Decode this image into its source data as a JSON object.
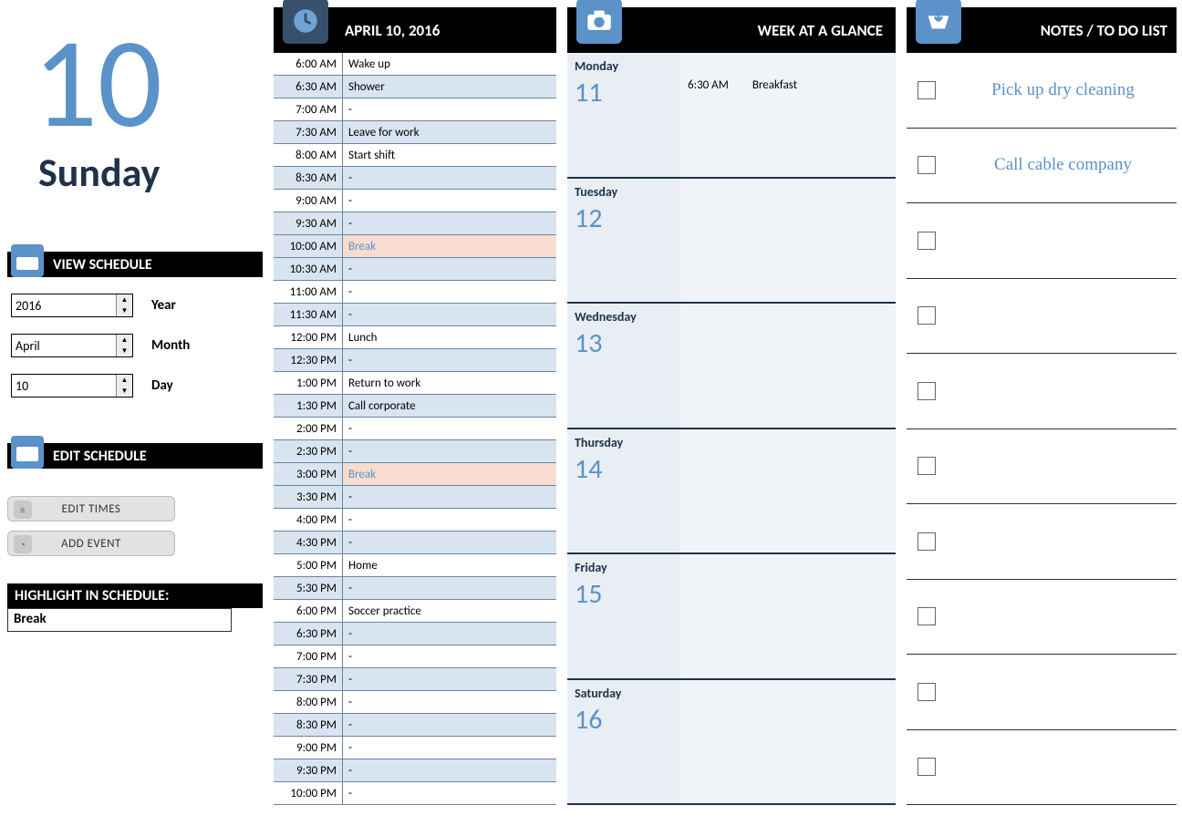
{
  "accent_color": "#5b92c9",
  "sidebar": {
    "date_number": "10",
    "day_name": "Sunday",
    "view_schedule_label": "VIEW SCHEDULE",
    "year": {
      "value": "2016",
      "label": "Year"
    },
    "month": {
      "value": "April",
      "label": "Month"
    },
    "day": {
      "value": "10",
      "label": "Day"
    },
    "edit_schedule_label": "EDIT SCHEDULE",
    "edit_times_btn": "EDIT TIMES",
    "add_event_btn": "ADD EVENT",
    "highlight_label": "HIGHLIGHT IN SCHEDULE:",
    "highlight_value": "Break"
  },
  "schedule": {
    "header": "APRIL 10, 2016",
    "rows": [
      {
        "time": "6:00 AM",
        "event": "Wake up",
        "alt": false,
        "hl": false
      },
      {
        "time": "6:30 AM",
        "event": "Shower",
        "alt": true,
        "hl": false
      },
      {
        "time": "7:00 AM",
        "event": "-",
        "alt": false,
        "hl": false
      },
      {
        "time": "7:30 AM",
        "event": "Leave for work",
        "alt": true,
        "hl": false
      },
      {
        "time": "8:00 AM",
        "event": "Start shift",
        "alt": false,
        "hl": false
      },
      {
        "time": "8:30 AM",
        "event": "-",
        "alt": true,
        "hl": false
      },
      {
        "time": "9:00 AM",
        "event": "-",
        "alt": false,
        "hl": false
      },
      {
        "time": "9:30 AM",
        "event": "-",
        "alt": true,
        "hl": false
      },
      {
        "time": "10:00 AM",
        "event": "Break",
        "alt": false,
        "hl": true
      },
      {
        "time": "10:30 AM",
        "event": "-",
        "alt": true,
        "hl": false
      },
      {
        "time": "11:00 AM",
        "event": "-",
        "alt": false,
        "hl": false
      },
      {
        "time": "11:30 AM",
        "event": "-",
        "alt": true,
        "hl": false
      },
      {
        "time": "12:00 PM",
        "event": "Lunch",
        "alt": false,
        "hl": false
      },
      {
        "time": "12:30 PM",
        "event": "-",
        "alt": true,
        "hl": false
      },
      {
        "time": "1:00 PM",
        "event": "Return to work",
        "alt": false,
        "hl": false
      },
      {
        "time": "1:30 PM",
        "event": "Call corporate",
        "alt": true,
        "hl": false
      },
      {
        "time": "2:00 PM",
        "event": "-",
        "alt": false,
        "hl": false
      },
      {
        "time": "2:30 PM",
        "event": "-",
        "alt": true,
        "hl": false
      },
      {
        "time": "3:00 PM",
        "event": "Break",
        "alt": false,
        "hl": true
      },
      {
        "time": "3:30 PM",
        "event": "-",
        "alt": true,
        "hl": false
      },
      {
        "time": "4:00 PM",
        "event": "-",
        "alt": false,
        "hl": false
      },
      {
        "time": "4:30 PM",
        "event": "-",
        "alt": true,
        "hl": false
      },
      {
        "time": "5:00 PM",
        "event": "Home",
        "alt": false,
        "hl": false
      },
      {
        "time": "5:30 PM",
        "event": "-",
        "alt": true,
        "hl": false
      },
      {
        "time": "6:00 PM",
        "event": "Soccer practice",
        "alt": false,
        "hl": false
      },
      {
        "time": "6:30 PM",
        "event": "-",
        "alt": true,
        "hl": false
      },
      {
        "time": "7:00 PM",
        "event": "-",
        "alt": false,
        "hl": false
      },
      {
        "time": "7:30 PM",
        "event": "-",
        "alt": true,
        "hl": false
      },
      {
        "time": "8:00 PM",
        "event": "-",
        "alt": false,
        "hl": false
      },
      {
        "time": "8:30 PM",
        "event": "-",
        "alt": true,
        "hl": false
      },
      {
        "time": "9:00 PM",
        "event": "-",
        "alt": false,
        "hl": false
      },
      {
        "time": "9:30 PM",
        "event": "-",
        "alt": true,
        "hl": false
      },
      {
        "time": "10:00 PM",
        "event": "-",
        "alt": false,
        "hl": false
      }
    ]
  },
  "week": {
    "header": "WEEK AT A GLANCE",
    "days": [
      {
        "name": "Monday",
        "num": "11",
        "time": "6:30 AM",
        "event": "Breakfast"
      },
      {
        "name": "Tuesday",
        "num": "12",
        "time": "",
        "event": ""
      },
      {
        "name": "Wednesday",
        "num": "13",
        "time": "",
        "event": ""
      },
      {
        "name": "Thursday",
        "num": "14",
        "time": "",
        "event": ""
      },
      {
        "name": "Friday",
        "num": "15",
        "time": "",
        "event": ""
      },
      {
        "name": "Saturday",
        "num": "16",
        "time": "",
        "event": ""
      }
    ]
  },
  "notes": {
    "header": "NOTES / TO DO LIST",
    "items": [
      "Pick up dry cleaning",
      "Call cable company",
      "",
      "",
      "",
      "",
      "",
      "",
      "",
      ""
    ]
  }
}
